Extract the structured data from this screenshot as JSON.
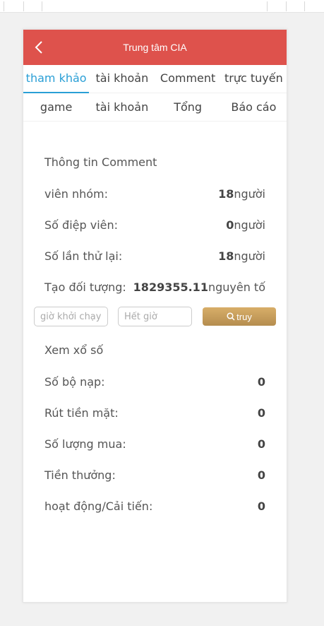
{
  "header": {
    "title": "Trung tâm CIA"
  },
  "tabs_row1": [
    "tham khảo",
    "tài khoản",
    "Comment",
    "trực tuyến"
  ],
  "tabs_row2": [
    "game",
    "tài khoản",
    "Tổng",
    "Báo cáo"
  ],
  "comment_section": {
    "title": "Thông tin Comment",
    "rows": [
      {
        "label": "viên nhóm:",
        "value": "18",
        "unit": "người"
      },
      {
        "label": "Số điệp viên:",
        "value": "0",
        "unit": "người"
      },
      {
        "label": "Số lần thử lại:",
        "value": "18",
        "unit": "người"
      },
      {
        "label": "Tạo đối tượng:",
        "value": "1829355.11",
        "unit": "nguyên tố"
      }
    ]
  },
  "filter": {
    "start_placeholder": "giờ khởi chạy",
    "end_placeholder": "Hết giờ",
    "query_label": "truy"
  },
  "lottery_section": {
    "title": "Xem xổ số",
    "rows": [
      {
        "label": "Số bộ nạp:",
        "value": "0"
      },
      {
        "label": "Rút tiền mặt:",
        "value": "0"
      },
      {
        "label": "Số lượng mua:",
        "value": "0"
      },
      {
        "label": "Tiền thưởng:",
        "value": "0"
      },
      {
        "label": "hoạt động/Cải tiến:",
        "value": "0"
      }
    ]
  },
  "colors": {
    "header": "#de524c",
    "active_tab": "#2a9fd6",
    "button": "#c9a05d"
  },
  "icons": {
    "back": "chevron-left-icon",
    "search": "search-icon"
  }
}
